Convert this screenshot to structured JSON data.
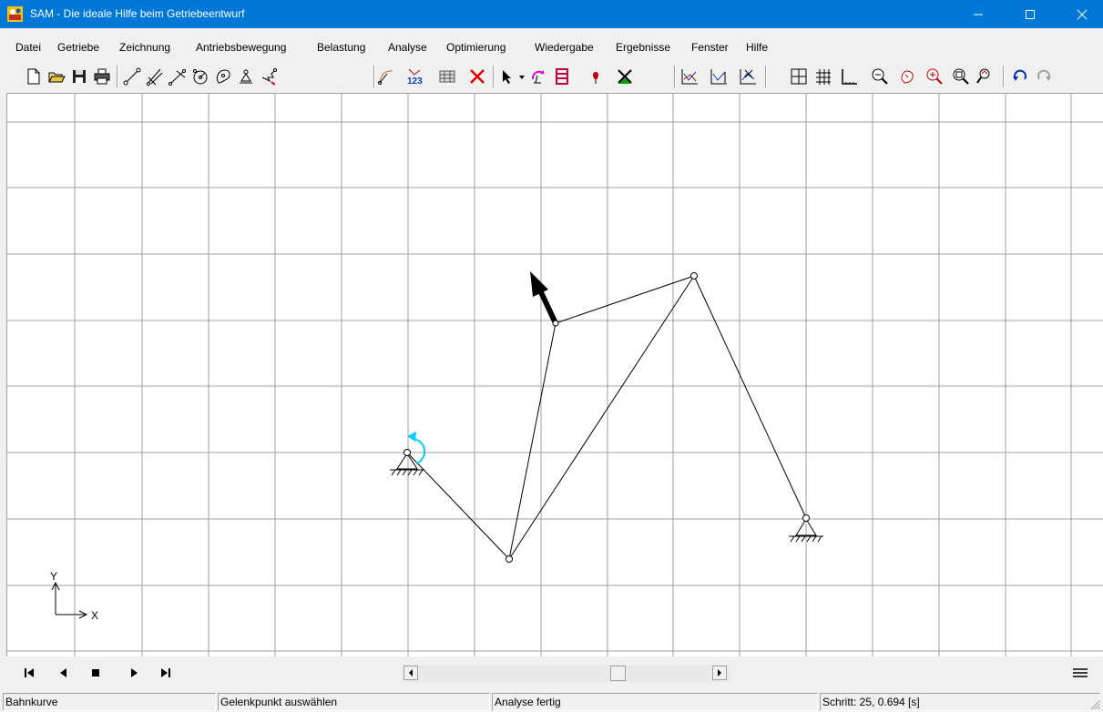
{
  "window": {
    "title": "SAM - Die ideale Hilfe beim Getriebeentwurf",
    "app_icon": "sam-app-icon",
    "controls": [
      "minimize-icon",
      "maximize-icon",
      "close-icon"
    ]
  },
  "menubar": {
    "items": [
      {
        "label": "Datei"
      },
      {
        "label": "Getriebe"
      },
      {
        "label": "Zeichnung"
      },
      {
        "label": "Antriebsbewegung"
      },
      {
        "label": "Belastung"
      },
      {
        "label": "Analyse"
      },
      {
        "label": "Optimierung"
      },
      {
        "label": "Wiedergabe"
      },
      {
        "label": "Ergebnisse"
      },
      {
        "label": "Fenster"
      },
      {
        "label": "Hilfe"
      }
    ]
  },
  "toolbar": {
    "icons": [
      "new-file-icon",
      "open-folder-icon",
      "save-icon",
      "print-icon",
      "beam-element-icon",
      "slider-element-icon",
      "slider-beam-icon",
      "gear-pair-icon",
      "cam-icon",
      "support-icon",
      "spring-icon",
      "motion-path-icon",
      "numbering-icon",
      "matrix-icon",
      "delete-icon",
      "select-arrow-icon",
      "dropdown-icon",
      "driving-motion-icon",
      "load-icon",
      "force-icon",
      "analysis-icon",
      "graph-icon",
      "graph-compare-icon",
      "graph-delete-icon",
      "grid-toggle-icon",
      "grid-settings-icon",
      "axes-icon",
      "zoom-out-icon",
      "pan-icon",
      "zoom-in-icon",
      "zoom-fit-icon",
      "zoom-window-icon",
      "undo-icon",
      "redo-icon"
    ]
  },
  "canvas": {
    "axis_x_label": "X",
    "axis_y_label": "Y",
    "colors": {
      "grid": "#a0a0a0",
      "link": "#000000",
      "drive_arrow": "#00cfff"
    }
  },
  "playback": {
    "controls": [
      "skip-to-start-icon",
      "step-back-icon",
      "stop-icon",
      "play-icon",
      "skip-to-end-icon"
    ],
    "menu_icon": "hamburger-menu-icon"
  },
  "statusbar": {
    "panel1": "Bahnkurve",
    "panel2": "Gelenkpunkt auswählen",
    "panel3": "Analyse fertig",
    "panel4": "Schritt: 25,   0.694 [s]"
  }
}
